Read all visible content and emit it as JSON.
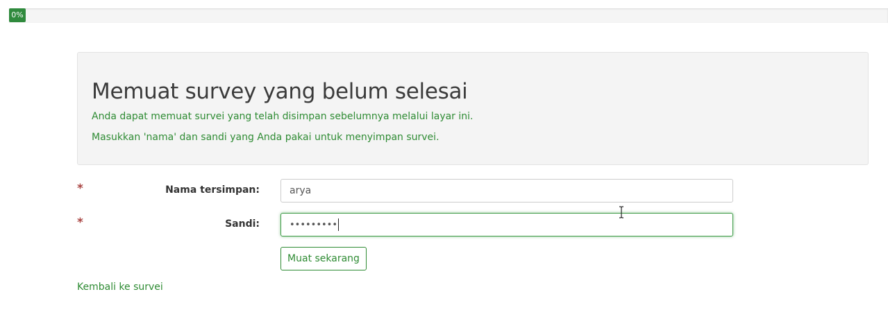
{
  "progress": {
    "label": "0%",
    "value": 0
  },
  "header": {
    "title": "Memuat survey yang belum selesai",
    "line1": "Anda dapat memuat survei yang telah disimpan sebelumnya melalui layar ini.",
    "line2": "Masukkan 'nama' dan sandi yang Anda pakai untuk menyimpan survei."
  },
  "form": {
    "required_mark": "*",
    "name_label": "Nama tersimpan:",
    "name_value": "arya",
    "password_label": "Sandi:",
    "password_value": "•••••••••",
    "submit_label": "Muat sekarang"
  },
  "footer": {
    "back_label": "Kembali ke survei"
  },
  "colors": {
    "accent": "#2e8b33",
    "progress": "#2f8a3d",
    "required": "#a94442"
  },
  "icons": {
    "cursor": "text-cursor-icon"
  }
}
